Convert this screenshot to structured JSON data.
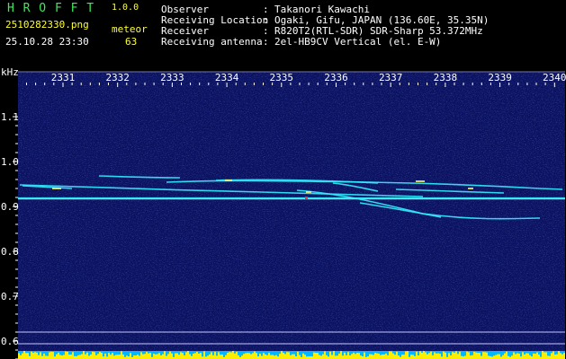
{
  "header": {
    "app_title": "H R O F F T",
    "version": "1.0.0",
    "filename": "2510282330.png",
    "timestamp": "25.10.28 23:30",
    "meteor_label": "meteor",
    "meteor_count": "63",
    "info": [
      {
        "key": "Observer",
        "sep": ":",
        "value": "Takanori Kawachi"
      },
      {
        "key": "Receiving Location",
        "sep": ":",
        "value": "Ogaki, Gifu, JAPAN (136.60E, 35.35N)"
      },
      {
        "key": "Receiver",
        "sep": ":",
        "value": "R820T2(RTL-SDR) SDR-Sharp 53.372MHz"
      },
      {
        "key": "Receiving antenna",
        "sep": ":",
        "value": "2el-HB9CV Vertical (el. E-W)"
      }
    ]
  },
  "spectrogram": {
    "y_unit": "kHz",
    "y_ticks": [
      "1.1",
      "1.0",
      "0.9",
      "0.8",
      "0.7",
      "0.6"
    ],
    "x_ticks": [
      "2331",
      "2332",
      "2333",
      "2334",
      "2335",
      "2336",
      "2337",
      "2338",
      "2339",
      "2340"
    ],
    "colors": {
      "background": "#0b1260",
      "trace": "#33eeff",
      "trace_peak": "#ffff66",
      "hot": "#ff3030",
      "baseline_bars": "#ffee00",
      "baseline_fill": "#00b8ff",
      "guide_line": "#c8c8ff"
    }
  }
}
